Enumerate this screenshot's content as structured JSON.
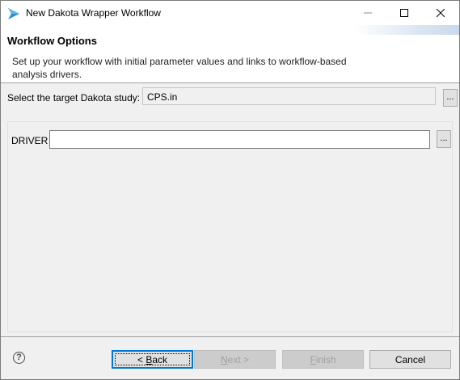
{
  "window": {
    "title": "New Dakota Wrapper Workflow",
    "icon": "dakota-arrow-icon",
    "controls": [
      "minimize-icon",
      "maximize-icon",
      "close-icon"
    ]
  },
  "header": {
    "title": "Workflow Options",
    "description": "Set up your workflow with initial parameter values and links to workflow-based analysis drivers."
  },
  "study": {
    "label": "Select the target Dakota study:",
    "value": "CPS.in",
    "browse_label": "..."
  },
  "driver": {
    "label": "DRIVER",
    "value": "",
    "browse_label": "..."
  },
  "buttons": {
    "back_mnemonic": "B",
    "back_prefix": "< ",
    "back_rest": "ack",
    "next_mnemonic": "N",
    "next_rest": "ext >",
    "finish_mnemonic": "F",
    "finish_rest": "inish",
    "cancel": "Cancel"
  },
  "help_icon": "?",
  "colors": {
    "focus_blue": "#0078d7",
    "button_bg": "#e1e1e1",
    "dialog_bg": "#f0f0f0"
  }
}
